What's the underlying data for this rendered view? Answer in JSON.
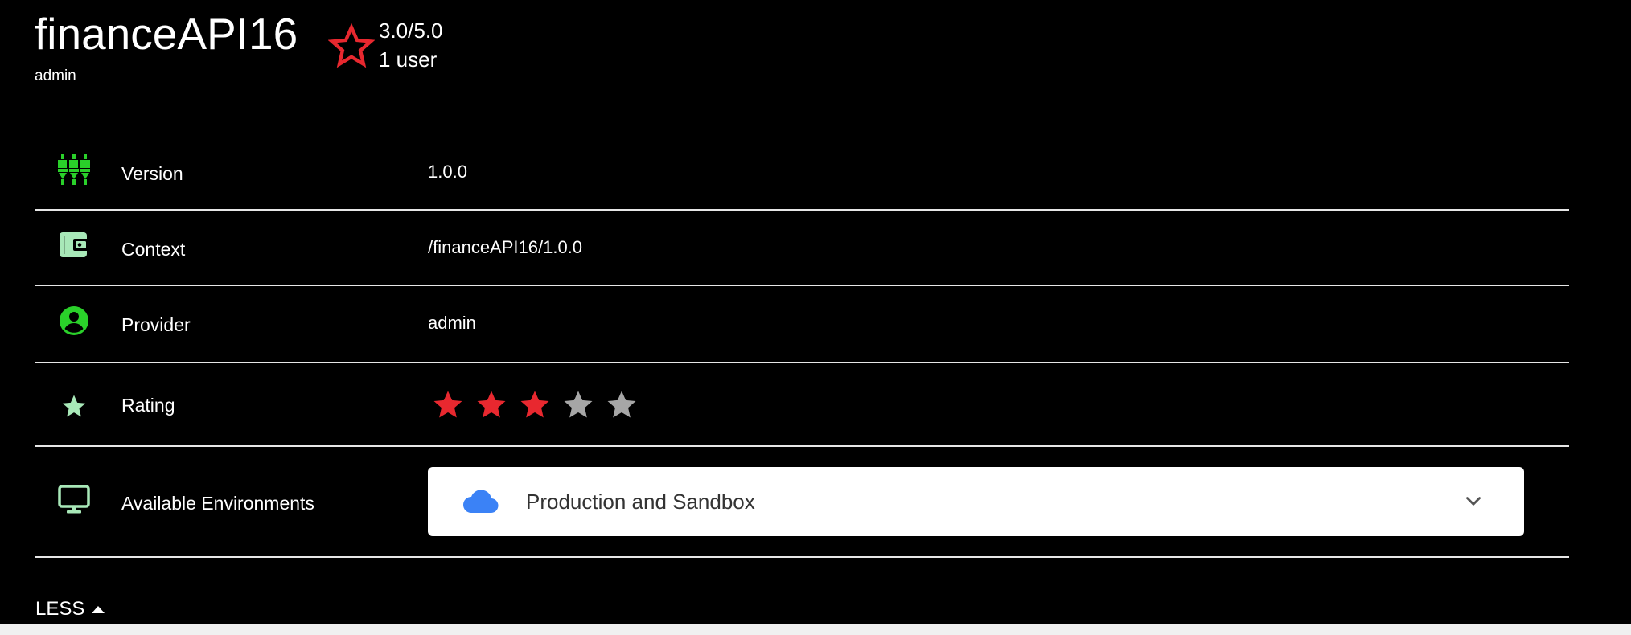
{
  "header": {
    "api_name": "financeAPI16",
    "owner": "admin",
    "rating_score": "3.0/5.0",
    "rating_users": "1 user"
  },
  "details": {
    "version": {
      "label": "Version",
      "value": "1.0.0",
      "icon": "connector-icon"
    },
    "context": {
      "label": "Context",
      "value": "/financeAPI16/1.0.0",
      "icon": "wallet-icon"
    },
    "provider": {
      "label": "Provider",
      "value": "admin",
      "icon": "user-circle-icon"
    },
    "rating": {
      "label": "Rating",
      "value": 3,
      "max": 5,
      "icon": "star-icon"
    },
    "environments": {
      "label": "Available Environments",
      "selected": "Production and Sandbox",
      "icon": "monitor-icon"
    }
  },
  "toggle": {
    "label": "LESS"
  },
  "colors": {
    "accent_green": "#2ad02a",
    "light_green": "#a8e8b8",
    "star_red": "#e8282f",
    "star_grey": "#a6a6a6",
    "cloud_blue": "#3b82f6",
    "background": "#000000"
  }
}
